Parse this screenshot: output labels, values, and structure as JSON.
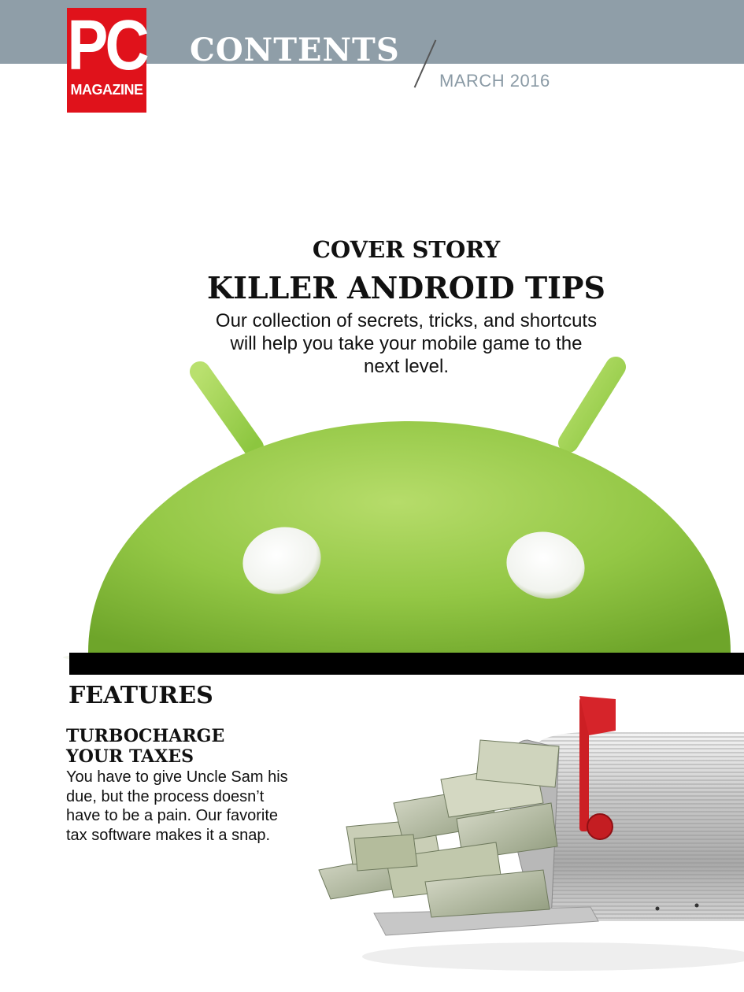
{
  "header": {
    "logo": {
      "top": "PC",
      "bottom": "MAGAZINE"
    },
    "section_title": "CONTENTS",
    "issue_date": "MARCH 2016",
    "band_color": "#8f9ea8",
    "logo_color": "#e0121b"
  },
  "cover_story": {
    "label": "COVER STORY",
    "headline": "KILLER ANDROID TIPS",
    "blurb": "Our collection of secrets, tricks, and shortcuts will help you take your mobile game to the next level.",
    "image": "android-robot-head-illustration",
    "accent_color": "#8cc63f"
  },
  "features": {
    "heading": "FEATURES",
    "items": [
      {
        "title_line1": "TURBOCHARGE",
        "title_line2": "YOUR TAXES",
        "blurb": "You have to give Uncle Sam his due, but the process doesn’t have to be a pain. Our favorite tax software makes it a snap.",
        "image": "mailbox-stuffed-with-cash-illustration"
      }
    ]
  }
}
